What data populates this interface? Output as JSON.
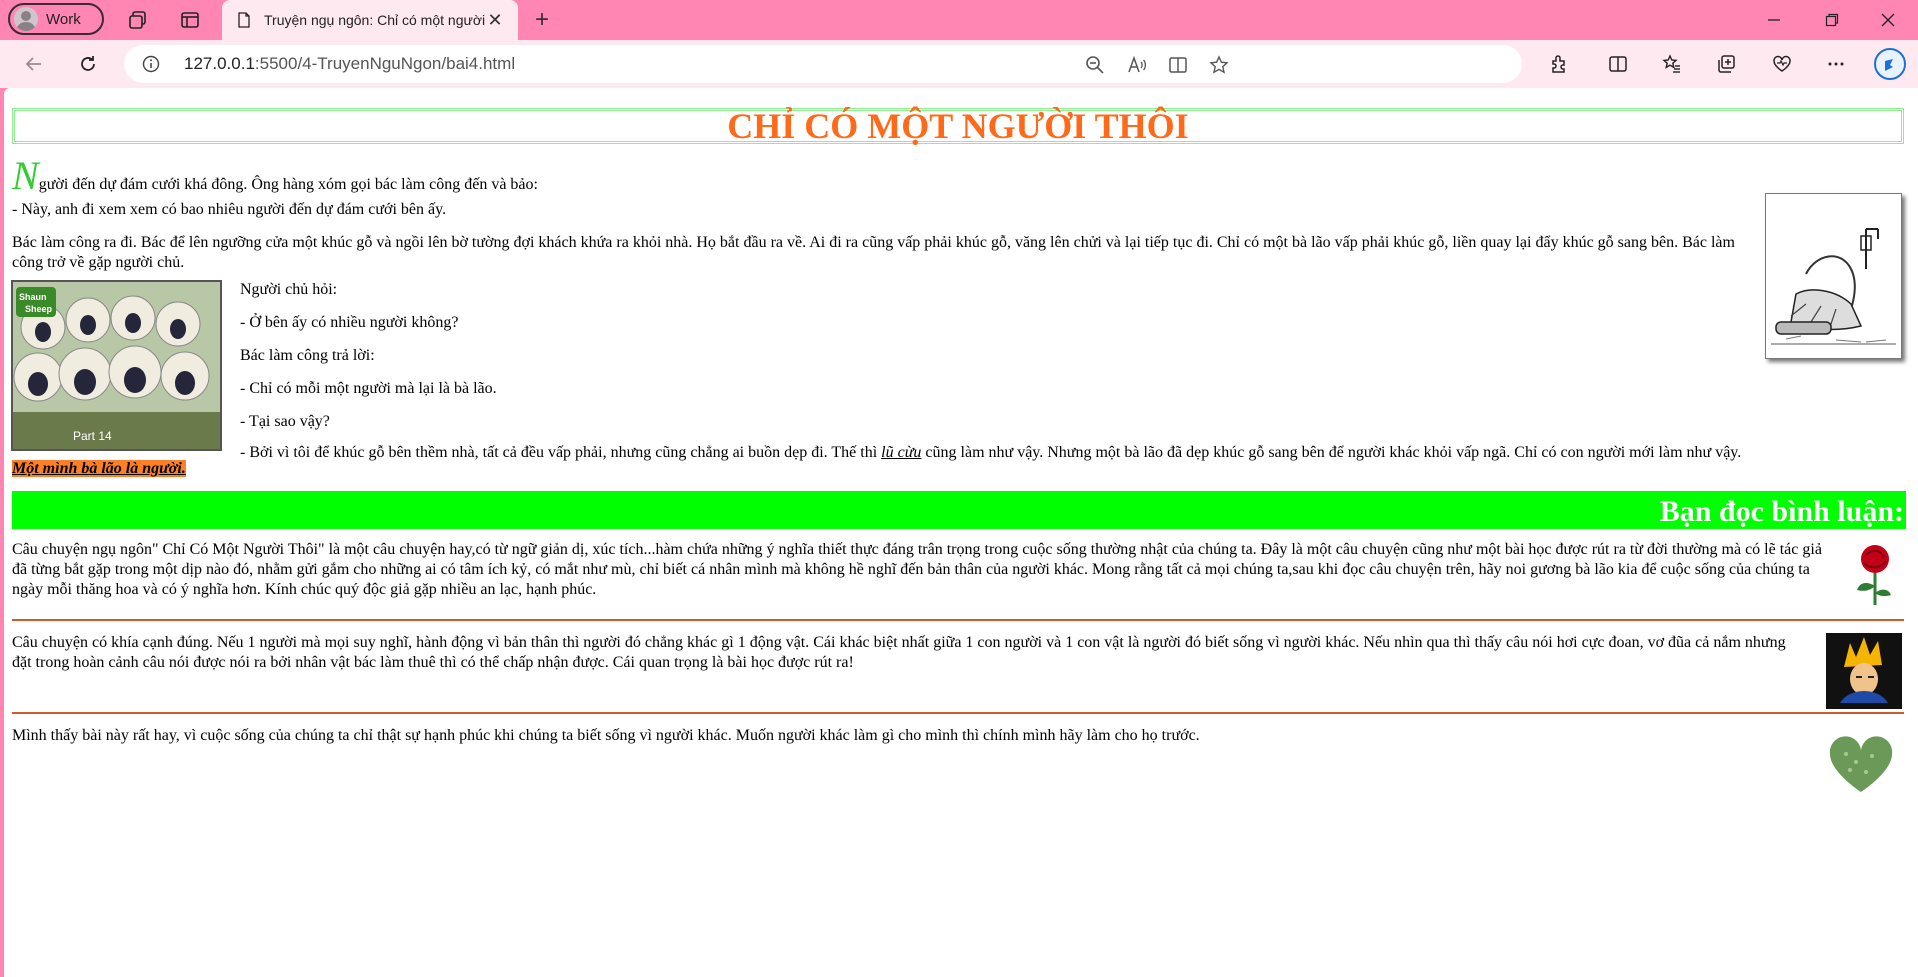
{
  "browser": {
    "profile_label": "Work",
    "tab_title": "Truyện ngụ ngôn: Chỉ có một người thôi",
    "url_host": "127.0.0.1",
    "url_rest": ":5500/4-TruyenNguNgon/bai4.html"
  },
  "page": {
    "title": "CHỈ CÓ MỘT NGƯỜI THÔI",
    "drop_cap": "N",
    "para1_rest": "gười đến dự đám cưới khá đông. Ông hàng xóm gọi bác làm công đến và bảo:",
    "para2": "- Này, anh đi xem xem có bao nhiêu người đến dự đám cưới bên ấy.",
    "para3": "Bác làm công ra đi. Bác để lên ngưỡng cửa một khúc gỗ và ngồi lên bờ tường đợi khách khứa ra khỏi nhà. Họ bắt đầu ra về. Ai đi ra cũng vấp phải khúc gỗ, văng lên chửi và lại tiếp tục đi. Chỉ có một bà lão vấp phải khúc gỗ, liền quay lại đẩy khúc gỗ sang bên. Bác làm công trở về gặp người chủ.",
    "dialog": [
      "Người chủ hỏi:",
      "- Ở bên ấy có nhiều người không?",
      "Bác làm công trả lời:",
      "- Chỉ có mỗi một người mà lại là bà lão.",
      "- Tại sao vậy?"
    ],
    "final_before": "- Bởi vì tôi để khúc gỗ bên thềm nhà, tất cả đều vấp phải, nhưng cũng chẳng ai buồn dẹp đi. Thế thì ",
    "final_link": "lũ cừu",
    "final_after": " cũng làm như vậy. Nhưng một bà lão đã dẹp khúc gỗ sang bên để người khác khỏi vấp ngã. Chỉ có con người mới làm như vậy.",
    "highlight": "Một mình bà lão là người.",
    "sheep_badge": "Shaun the Sheep",
    "sheep_caption": "Part 14",
    "comments_heading": "Bạn đọc bình luận:",
    "comments": [
      "Câu chuyện ngụ ngôn\" Chỉ Có Một Người Thôi\" là một câu chuyện hay,có từ ngữ giản dị, xúc tích...hàm chứa những ý nghĩa thiết thực đáng trân trọng trong cuộc sống thường nhật của chúng ta. Đây là một câu chuyện cũng như một bài học được rút ra từ đời thường mà có lẽ tác giả đã từng bắt gặp trong một dịp nào đó, nhằm gửi gắm cho những ai có tâm ích kỷ, có mắt như mù, chỉ biết cá nhân mình mà không hề nghĩ đến bản thân của người khác. Mong rằng tất cả mọi chúng ta,sau khi đọc câu chuyện trên, hãy noi gương bà lão kia để cuộc sống của chúng ta ngày mỗi thăng hoa và có ý nghĩa hơn. Kính chúc quý độc giả gặp nhiều an lạc, hạnh phúc.",
      "Câu chuyện có khía cạnh đúng. Nếu 1 người mà mọi suy nghĩ, hành động vì bản thân thì người đó chẳng khác gì 1 động vật. Cái khác biệt nhất giữa 1 con người và 1 con vật là người đó biết sống vì người khác. Nếu nhìn qua thì thấy câu nói hơi cực đoan, vơ đũa cả nắm nhưng đặt trong hoàn cảnh câu nói được nói ra bởi nhân vật bác làm thuê thì có thể chấp nhận được. Cái quan trọng là bài học được rút ra!",
      "Mình thấy bài này rất hay, vì cuộc sống của chúng ta chỉ thật sự hạnh phúc khi chúng ta biết sống vì người khác. Muốn người khác làm gì cho mình thì chính mình hãy làm cho họ trước."
    ]
  },
  "colors": {
    "chrome_pink": "#ff85b3",
    "title_orange": "#ff6a1a",
    "dropcap_green": "#33cc33",
    "comments_bar_green": "#00ff00",
    "highlight_orange": "#ff7f27",
    "divider": "#d05a2a"
  }
}
